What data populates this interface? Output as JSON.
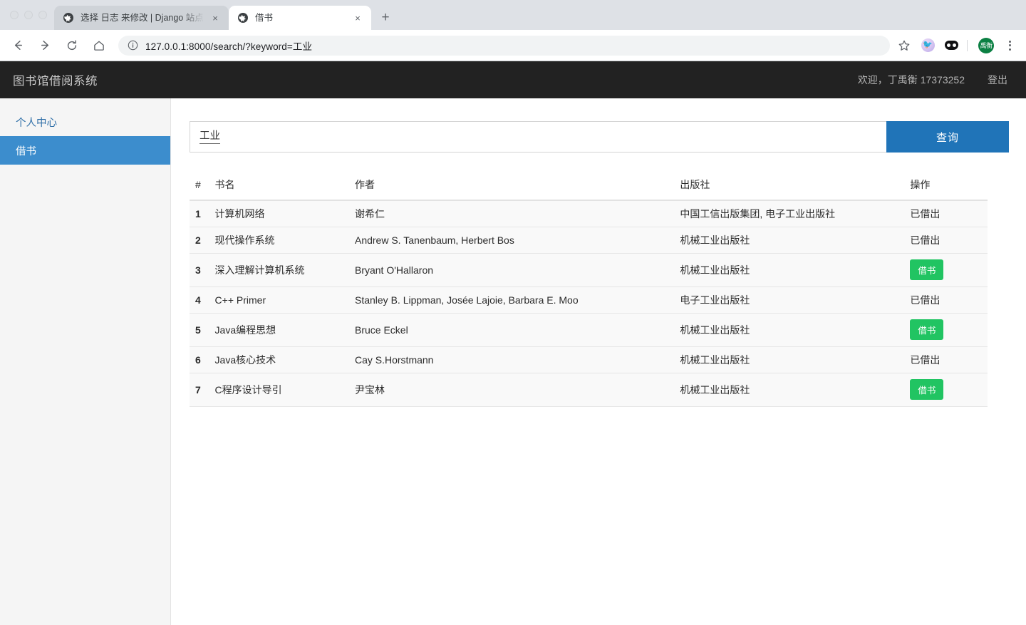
{
  "browser": {
    "tabs": [
      {
        "title": "选择 日志 来修改 | Django 站点管理",
        "favicon": "globe-icon",
        "active": false
      },
      {
        "title": "借书",
        "favicon": "globe-icon",
        "active": true
      }
    ],
    "new_tab_label": "+",
    "close_label": "×",
    "nav": {
      "back": "←",
      "forward": "→",
      "reload": "⟳",
      "home": "⌂"
    },
    "omnibox": {
      "url": "127.0.0.1:8000/search/?keyword=工业",
      "info_icon": "info-circle-icon"
    },
    "toolbar_icons": {
      "bookmark": "star-icon",
      "extension_bird": "bird-extension-icon",
      "extension_dark": "dark-extension-icon",
      "avatar_label": "禹衡",
      "menu": "three-dot-menu-icon"
    }
  },
  "header": {
    "brand": "图书馆借阅系统",
    "welcome": "欢迎，丁禹衡 17373252",
    "logout": "登出"
  },
  "sidebar": {
    "items": [
      {
        "label": "个人中心",
        "active": false
      },
      {
        "label": "借书",
        "active": true
      }
    ]
  },
  "search": {
    "value": "工业",
    "placeholder": "",
    "button_label": "查询"
  },
  "table": {
    "columns": [
      "#",
      "书名",
      "作者",
      "出版社",
      "操作"
    ],
    "rows": [
      {
        "index": "1",
        "title": "计算机网络",
        "author": "谢希仁",
        "publisher": "中国工信出版集团, 电子工业出版社",
        "action_type": "text",
        "action_label": "已借出"
      },
      {
        "index": "2",
        "title": "现代操作系统",
        "author": "Andrew S. Tanenbaum, Herbert Bos",
        "publisher": "机械工业出版社",
        "action_type": "text",
        "action_label": "已借出"
      },
      {
        "index": "3",
        "title": "深入理解计算机系统",
        "author": "Bryant O'Hallaron",
        "publisher": "机械工业出版社",
        "action_type": "button",
        "action_label": "借书"
      },
      {
        "index": "4",
        "title": "C++ Primer",
        "author": "Stanley B. Lippman, Josée Lajoie, Barbara E. Moo",
        "publisher": "电子工业出版社",
        "action_type": "text",
        "action_label": "已借出"
      },
      {
        "index": "5",
        "title": "Java编程思想",
        "author": "Bruce Eckel",
        "publisher": "机械工业出版社",
        "action_type": "button",
        "action_label": "借书"
      },
      {
        "index": "6",
        "title": "Java核心技术",
        "author": "Cay S.Horstmann",
        "publisher": "机械工业出版社",
        "action_type": "text",
        "action_label": "已借出"
      },
      {
        "index": "7",
        "title": "C程序设计导引",
        "author": "尹宝林",
        "publisher": "机械工业出版社",
        "action_type": "button",
        "action_label": "借书"
      }
    ]
  },
  "colors": {
    "appbar_bg": "#222222",
    "sidebar_active": "#3c8dcd",
    "search_button": "#2074b8",
    "borrow_button": "#21c462",
    "avatar_bg": "#0b8043"
  }
}
